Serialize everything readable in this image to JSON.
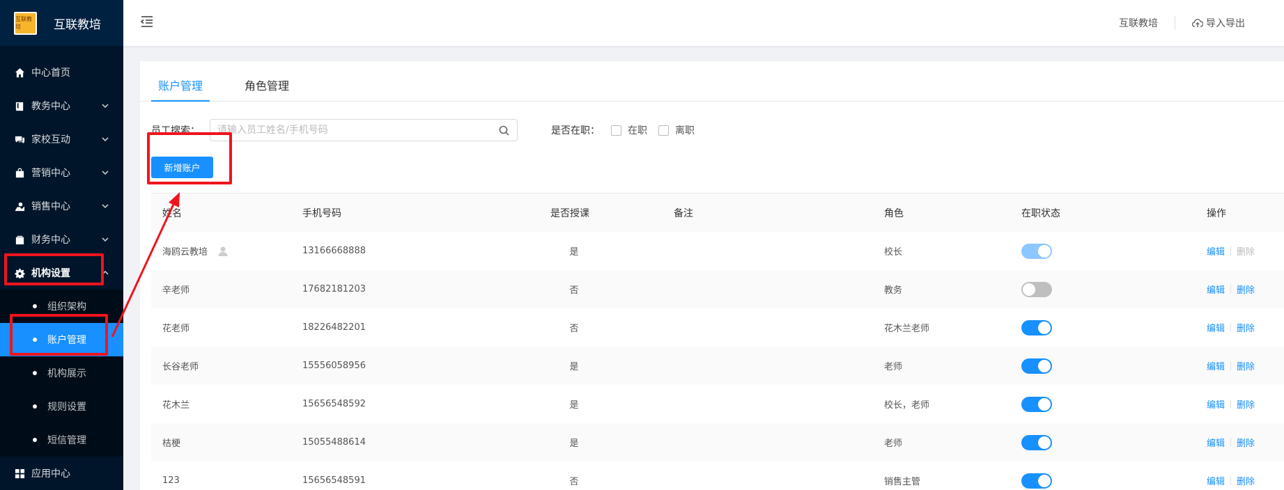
{
  "brand": {
    "logo_text": "互联教培",
    "title": "互联教培"
  },
  "sidebar": {
    "items": [
      {
        "label": "中心首页",
        "icon": "home-icon",
        "has_arrow": false
      },
      {
        "label": "教务中心",
        "icon": "book-icon",
        "has_arrow": true
      },
      {
        "label": "家校互动",
        "icon": "chat-icon",
        "has_arrow": true
      },
      {
        "label": "营销中心",
        "icon": "bag-icon",
        "has_arrow": true
      },
      {
        "label": "销售中心",
        "icon": "sales-icon",
        "has_arrow": true
      },
      {
        "label": "财务中心",
        "icon": "wallet-icon",
        "has_arrow": true
      },
      {
        "label": "机构设置",
        "icon": "gear-icon",
        "has_arrow": true,
        "open": true
      }
    ],
    "submenu": [
      {
        "label": "组织架构"
      },
      {
        "label": "账户管理",
        "active": true
      },
      {
        "label": "机构展示"
      },
      {
        "label": "规则设置"
      },
      {
        "label": "短信管理"
      }
    ],
    "after": {
      "label": "应用中心",
      "icon": "grid-icon"
    }
  },
  "header": {
    "org_name": "互联教培",
    "import_export": "导入导出"
  },
  "tabs": [
    {
      "label": "账户管理",
      "active": true
    },
    {
      "label": "角色管理",
      "active": false
    }
  ],
  "filter": {
    "search_label": "员工搜索：",
    "search_placeholder": "请输入员工姓名/手机号码",
    "search_value": "",
    "employed_label": "是否在职：",
    "options": [
      {
        "label": "在职",
        "checked": false
      },
      {
        "label": "离职",
        "checked": false
      }
    ]
  },
  "add_button": "新增账户",
  "table": {
    "columns": {
      "name": "姓名",
      "phone": "手机号码",
      "teaching": "是否授课",
      "note": "备注",
      "role": "角色",
      "status": "在职状态",
      "ops": "操作"
    },
    "edit_label": "编辑",
    "delete_label": "删除",
    "rows": [
      {
        "name": "海鸥云教培",
        "phone": "13166668888",
        "teaching": "是",
        "note": "",
        "role": "校长",
        "status": "disabled-on",
        "owner": true
      },
      {
        "name": "辛老师",
        "phone": "17682181203",
        "teaching": "否",
        "note": "",
        "role": "教务",
        "status": "off"
      },
      {
        "name": "花老师",
        "phone": "18226482201",
        "teaching": "否",
        "note": "",
        "role": "花木兰老师",
        "status": "on"
      },
      {
        "name": "长谷老师",
        "phone": "15556058956",
        "teaching": "是",
        "note": "",
        "role": "老师",
        "status": "on"
      },
      {
        "name": "花木兰",
        "phone": "15656548592",
        "teaching": "是",
        "note": "",
        "role": "校长，老师",
        "status": "on"
      },
      {
        "name": "桔梗",
        "phone": "15055488614",
        "teaching": "是",
        "note": "",
        "role": "老师",
        "status": "on"
      },
      {
        "name": "123",
        "phone": "15656548591",
        "teaching": "否",
        "note": "",
        "role": "销售主管",
        "status": "on"
      }
    ]
  },
  "colors": {
    "sidebar_bg": "#001529",
    "accent": "#1890ff",
    "annotation": "#f0141e"
  }
}
